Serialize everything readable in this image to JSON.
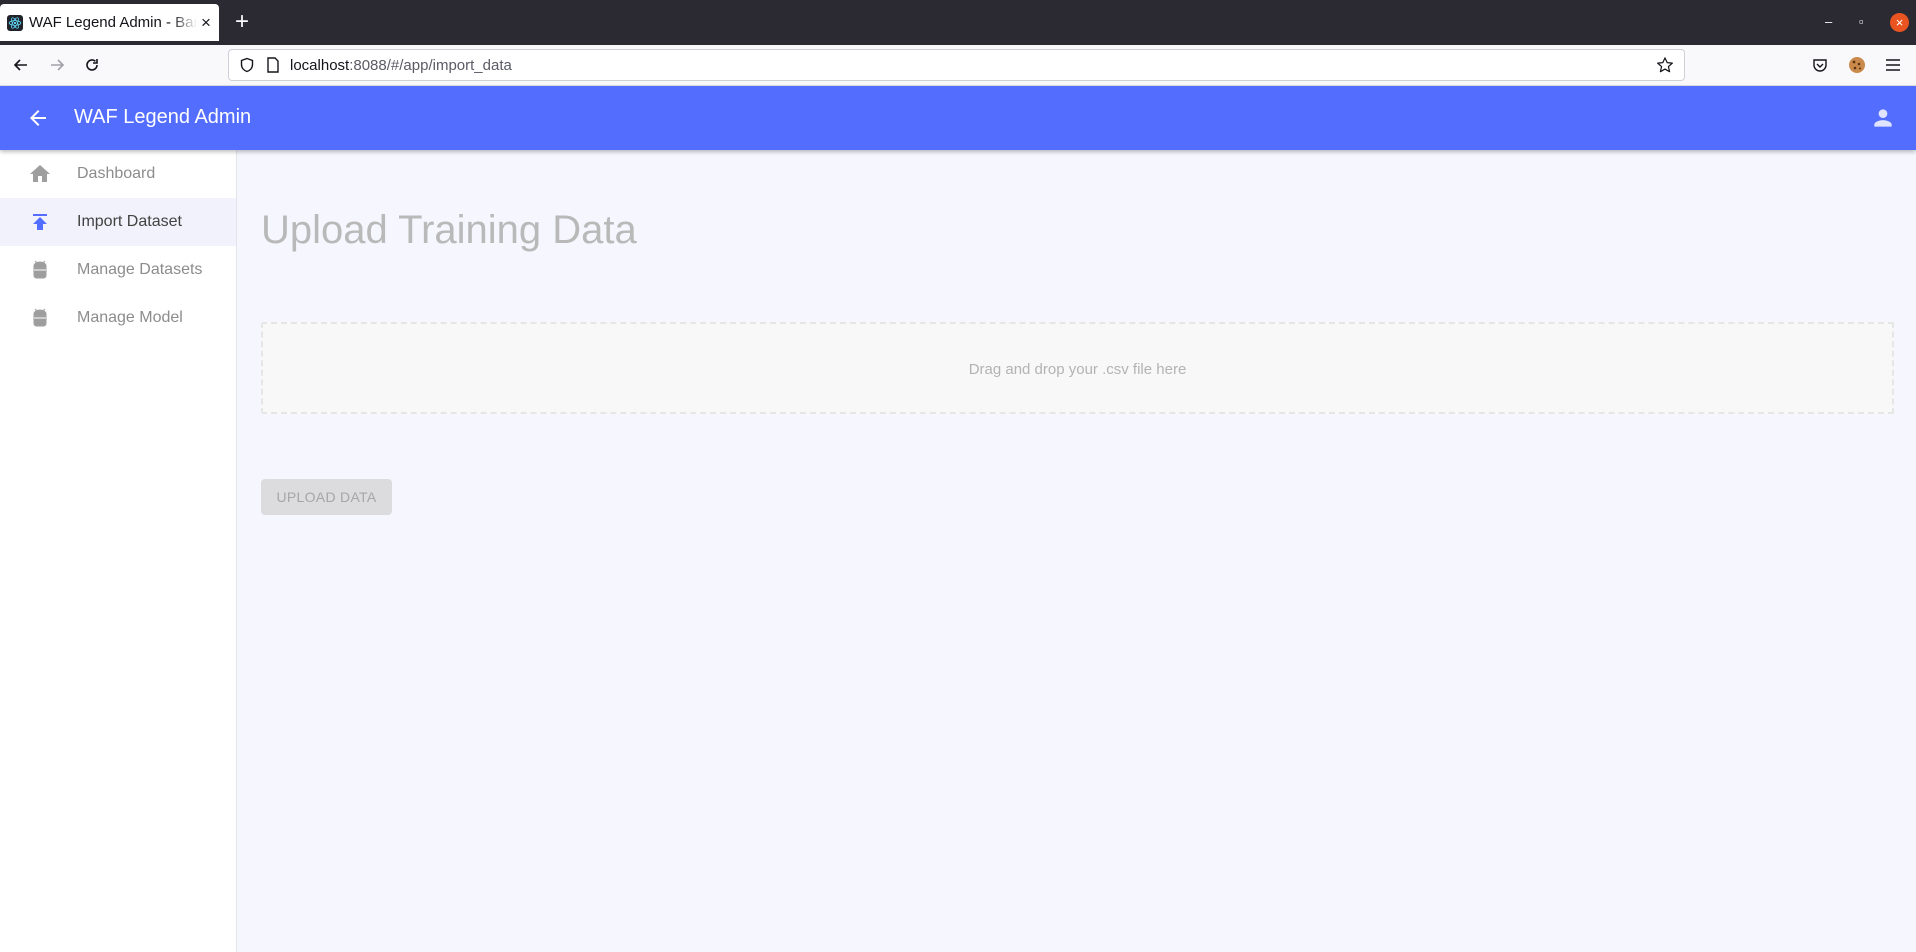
{
  "browser": {
    "tab_title": "WAF Legend Admin - Ban",
    "tab_close": "×",
    "new_tab": "+",
    "window_minimize": "–",
    "window_restore": "▫",
    "window_close": "×",
    "url_host": "localhost",
    "url_rest": ":8088/#/app/import_data"
  },
  "header": {
    "title": "WAF Legend Admin"
  },
  "sidebar": {
    "items": [
      {
        "label": "Dashboard",
        "icon": "home-icon",
        "active": false
      },
      {
        "label": "Import Dataset",
        "icon": "upload-icon",
        "active": true
      },
      {
        "label": "Manage Datasets",
        "icon": "android-icon",
        "active": false
      },
      {
        "label": "Manage Model",
        "icon": "android-icon",
        "active": false
      }
    ]
  },
  "main": {
    "title": "Upload Training Data",
    "dropzone_text": "Drag and drop your .csv file here",
    "upload_button": "UPLOAD DATA"
  },
  "colors": {
    "appbar": "#536dfe",
    "active_icon": "#536dfe",
    "inactive_icon": "#9e9e9e",
    "main_background": "#f5f6fe"
  }
}
